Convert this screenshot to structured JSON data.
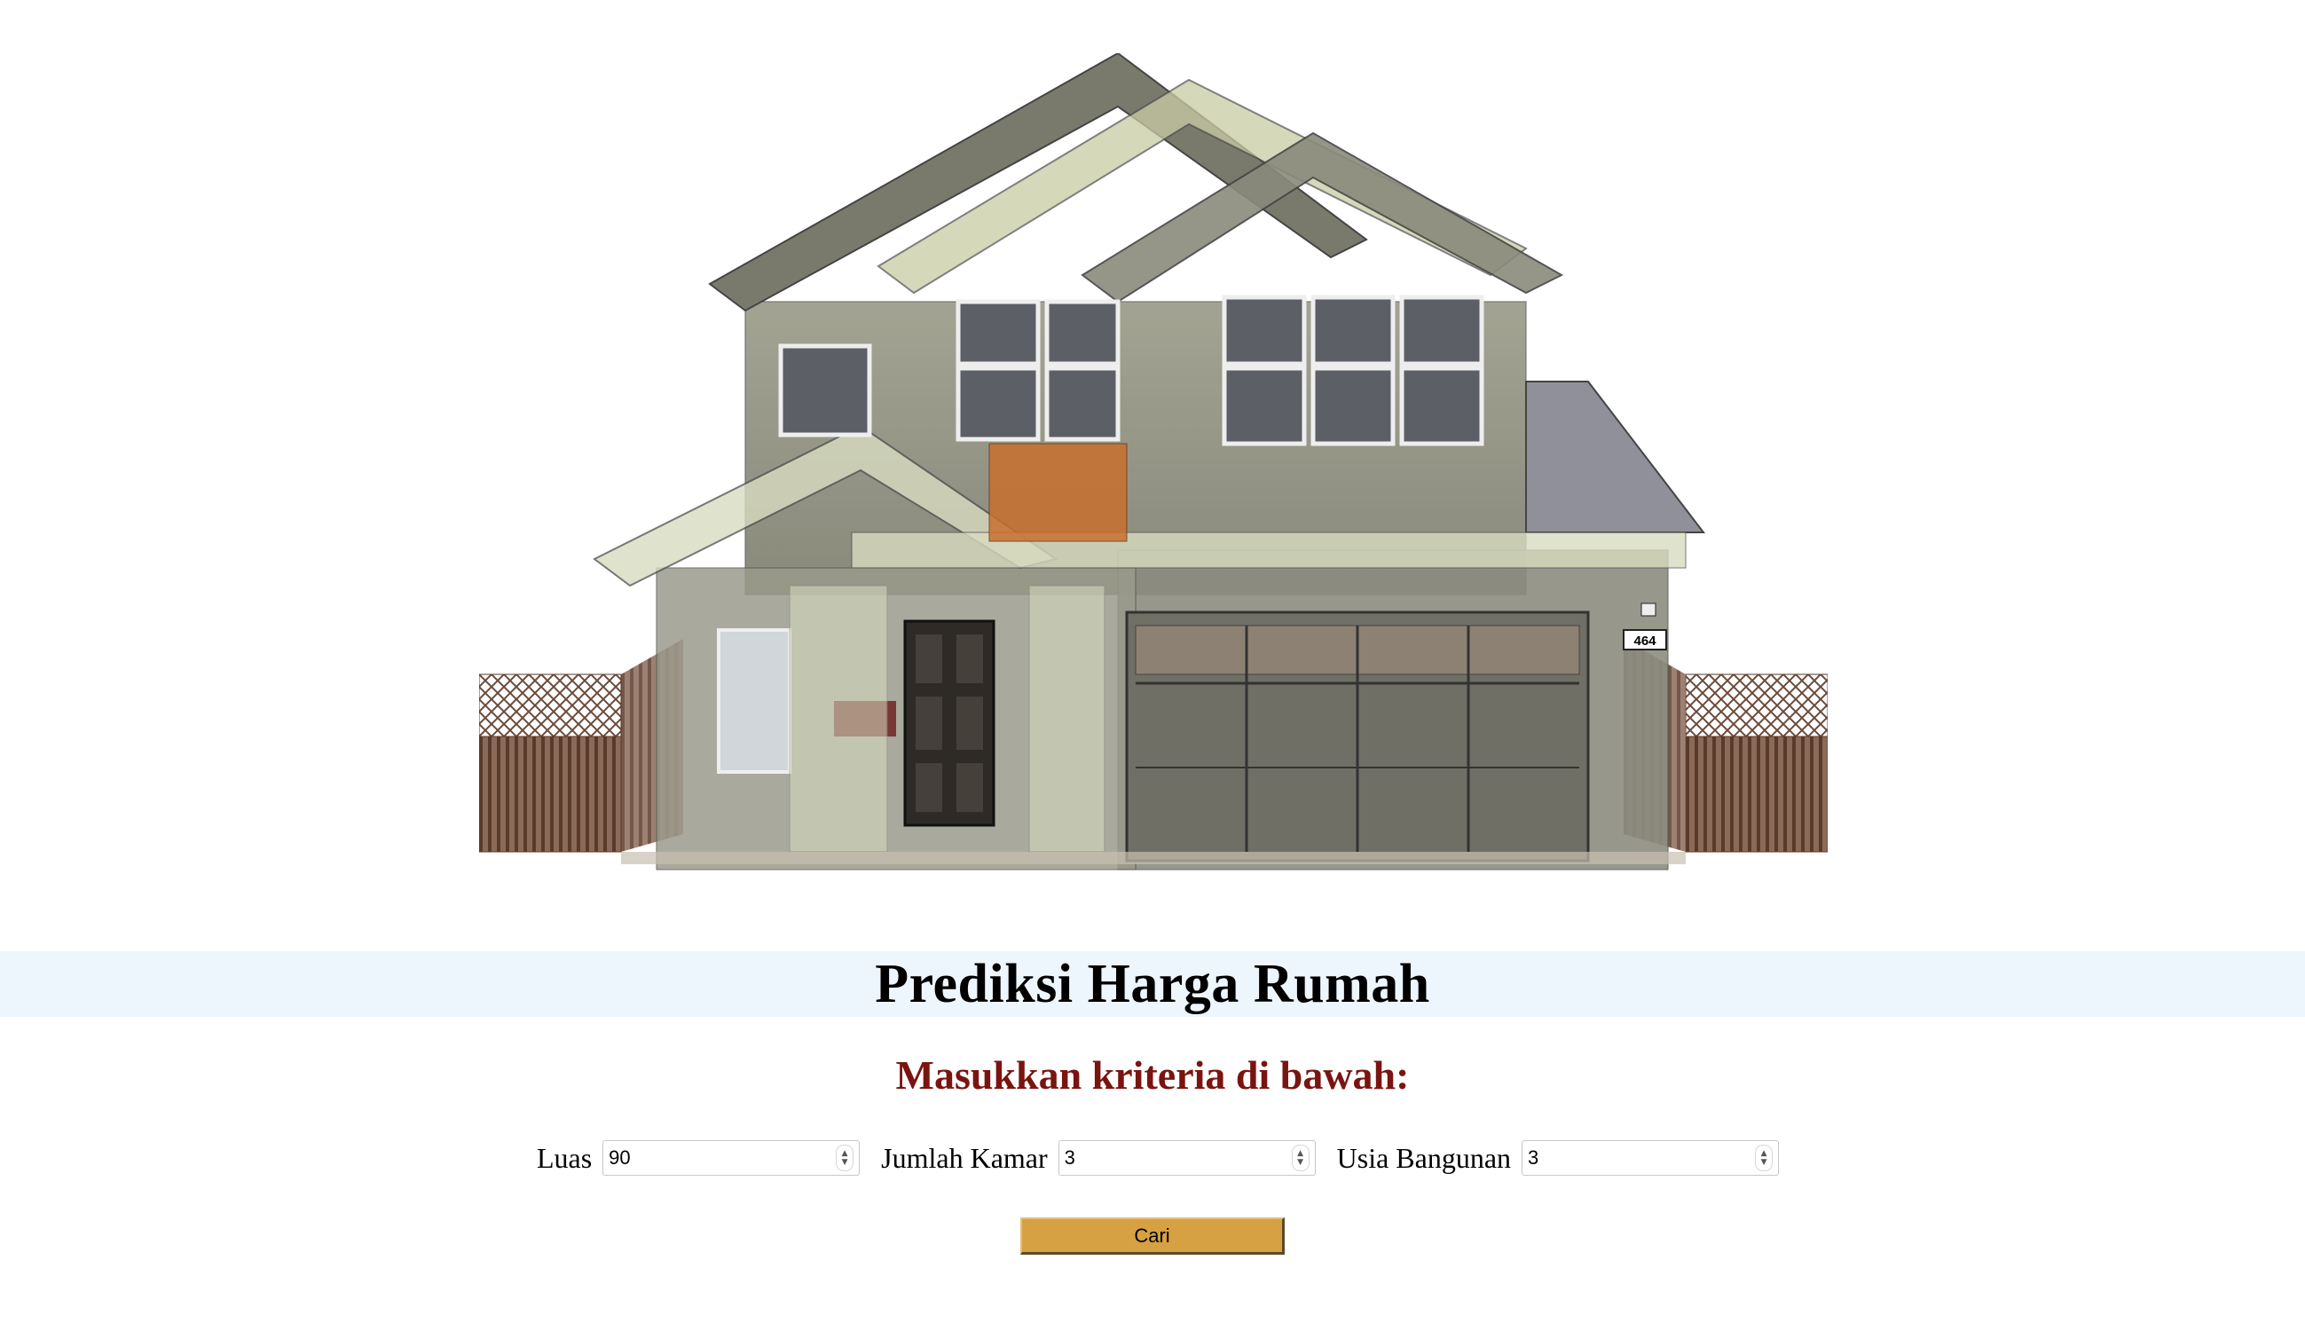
{
  "header": {
    "title": "Prediksi Harga Rumah",
    "subtitle": "Masukkan kriteria di bawah:"
  },
  "hero": {
    "house_number": "464"
  },
  "form": {
    "fields": [
      {
        "label": "Luas",
        "value": "90"
      },
      {
        "label": "Jumlah Kamar",
        "value": "3"
      },
      {
        "label": "Usia Bangunan",
        "value": "3"
      }
    ],
    "submit_label": "Cari"
  },
  "colors": {
    "title_band": "#eef6fd",
    "subtitle": "#7a1410",
    "button": "#d6a142"
  },
  "icons": {
    "spinner": "up-down-spinner-icon"
  }
}
